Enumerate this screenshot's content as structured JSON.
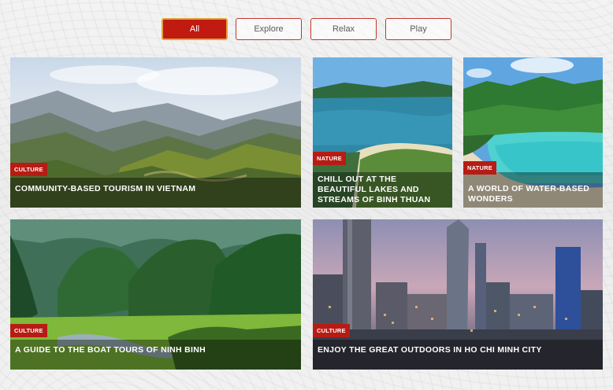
{
  "filters": {
    "all": "All",
    "explore": "Explore",
    "relax": "Relax",
    "play": "Play",
    "active": "All"
  },
  "cards": [
    {
      "category": "CULTURE",
      "title": "COMMUNITY-BASED TOURISM IN VIETNAM"
    },
    {
      "category": "NATURE",
      "title": "CHILL OUT AT THE BEAUTIFUL LAKES AND STREAMS OF BINH THUAN"
    },
    {
      "category": "NATURE",
      "title": "A WORLD OF WATER-BASED WONDERS"
    },
    {
      "category": "CULTURE",
      "title": "A GUIDE TO THE BOAT TOURS OF NINH BINH"
    },
    {
      "category": "CULTURE",
      "title": "ENJOY THE GREAT OUTDOORS IN HO CHI MINH CITY"
    }
  ],
  "colors": {
    "accent": "#c11a10",
    "badge": "#b71c14",
    "active_border": "#e0a33b"
  }
}
